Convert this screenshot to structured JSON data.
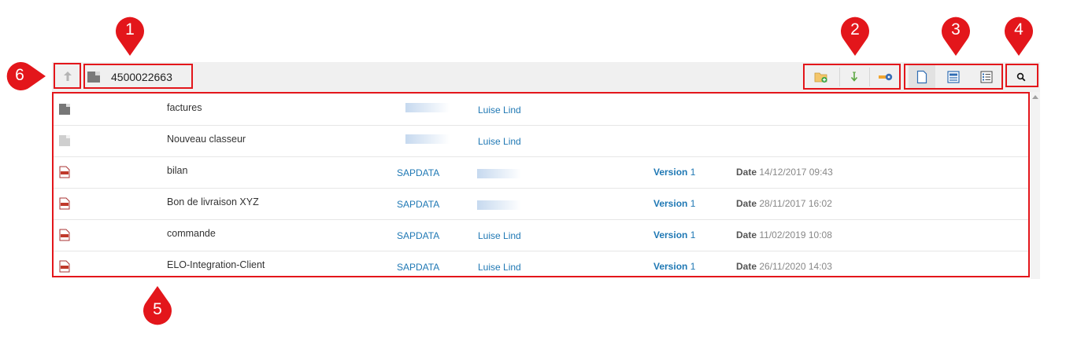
{
  "breadcrumb": {
    "title": "4500022663"
  },
  "toolbar": {
    "actions": [
      "folder-add-icon",
      "download-icon",
      "key-icon"
    ],
    "views": [
      "single-view-icon",
      "detail-view-icon",
      "list-view-icon"
    ],
    "search": "search-icon"
  },
  "markers": [
    "1",
    "2",
    "3",
    "4",
    "5",
    "6"
  ],
  "rows": [
    {
      "icon": "folder-dark-icon",
      "name": "factures",
      "user": "Luise Lind",
      "version_label": "",
      "version": "",
      "date_label": "",
      "date": ""
    },
    {
      "icon": "folder-light-icon",
      "name": "Nouveau classeur",
      "user": "Luise Lind",
      "version_label": "",
      "version": "",
      "date_label": "",
      "date": ""
    },
    {
      "icon": "pdf-icon",
      "name": "bilan",
      "source": "SAPDATA",
      "user": "",
      "version_label": "Version",
      "version": "1",
      "date_label": "Date",
      "date": "14/12/2017 09:43"
    },
    {
      "icon": "pdf-icon",
      "name": "Bon de livraison XYZ",
      "source": "SAPDATA",
      "user": "",
      "version_label": "Version",
      "version": "1",
      "date_label": "Date",
      "date": "28/11/2017 16:02"
    },
    {
      "icon": "pdf-icon",
      "name": "commande",
      "source": "SAPDATA",
      "user": "Luise Lind",
      "version_label": "Version",
      "version": "1",
      "date_label": "Date",
      "date": "11/02/2019 10:08"
    },
    {
      "icon": "pdf-icon",
      "name": "ELO-Integration-Client",
      "source": "SAPDATA",
      "user": "Luise Lind",
      "version_label": "Version",
      "version": "1",
      "date_label": "Date",
      "date": "26/11/2020 14:03"
    }
  ],
  "colors": {
    "accent_red": "#e3161b",
    "link_blue": "#1f78b4",
    "toolbar_bg": "#f0f0f0"
  }
}
